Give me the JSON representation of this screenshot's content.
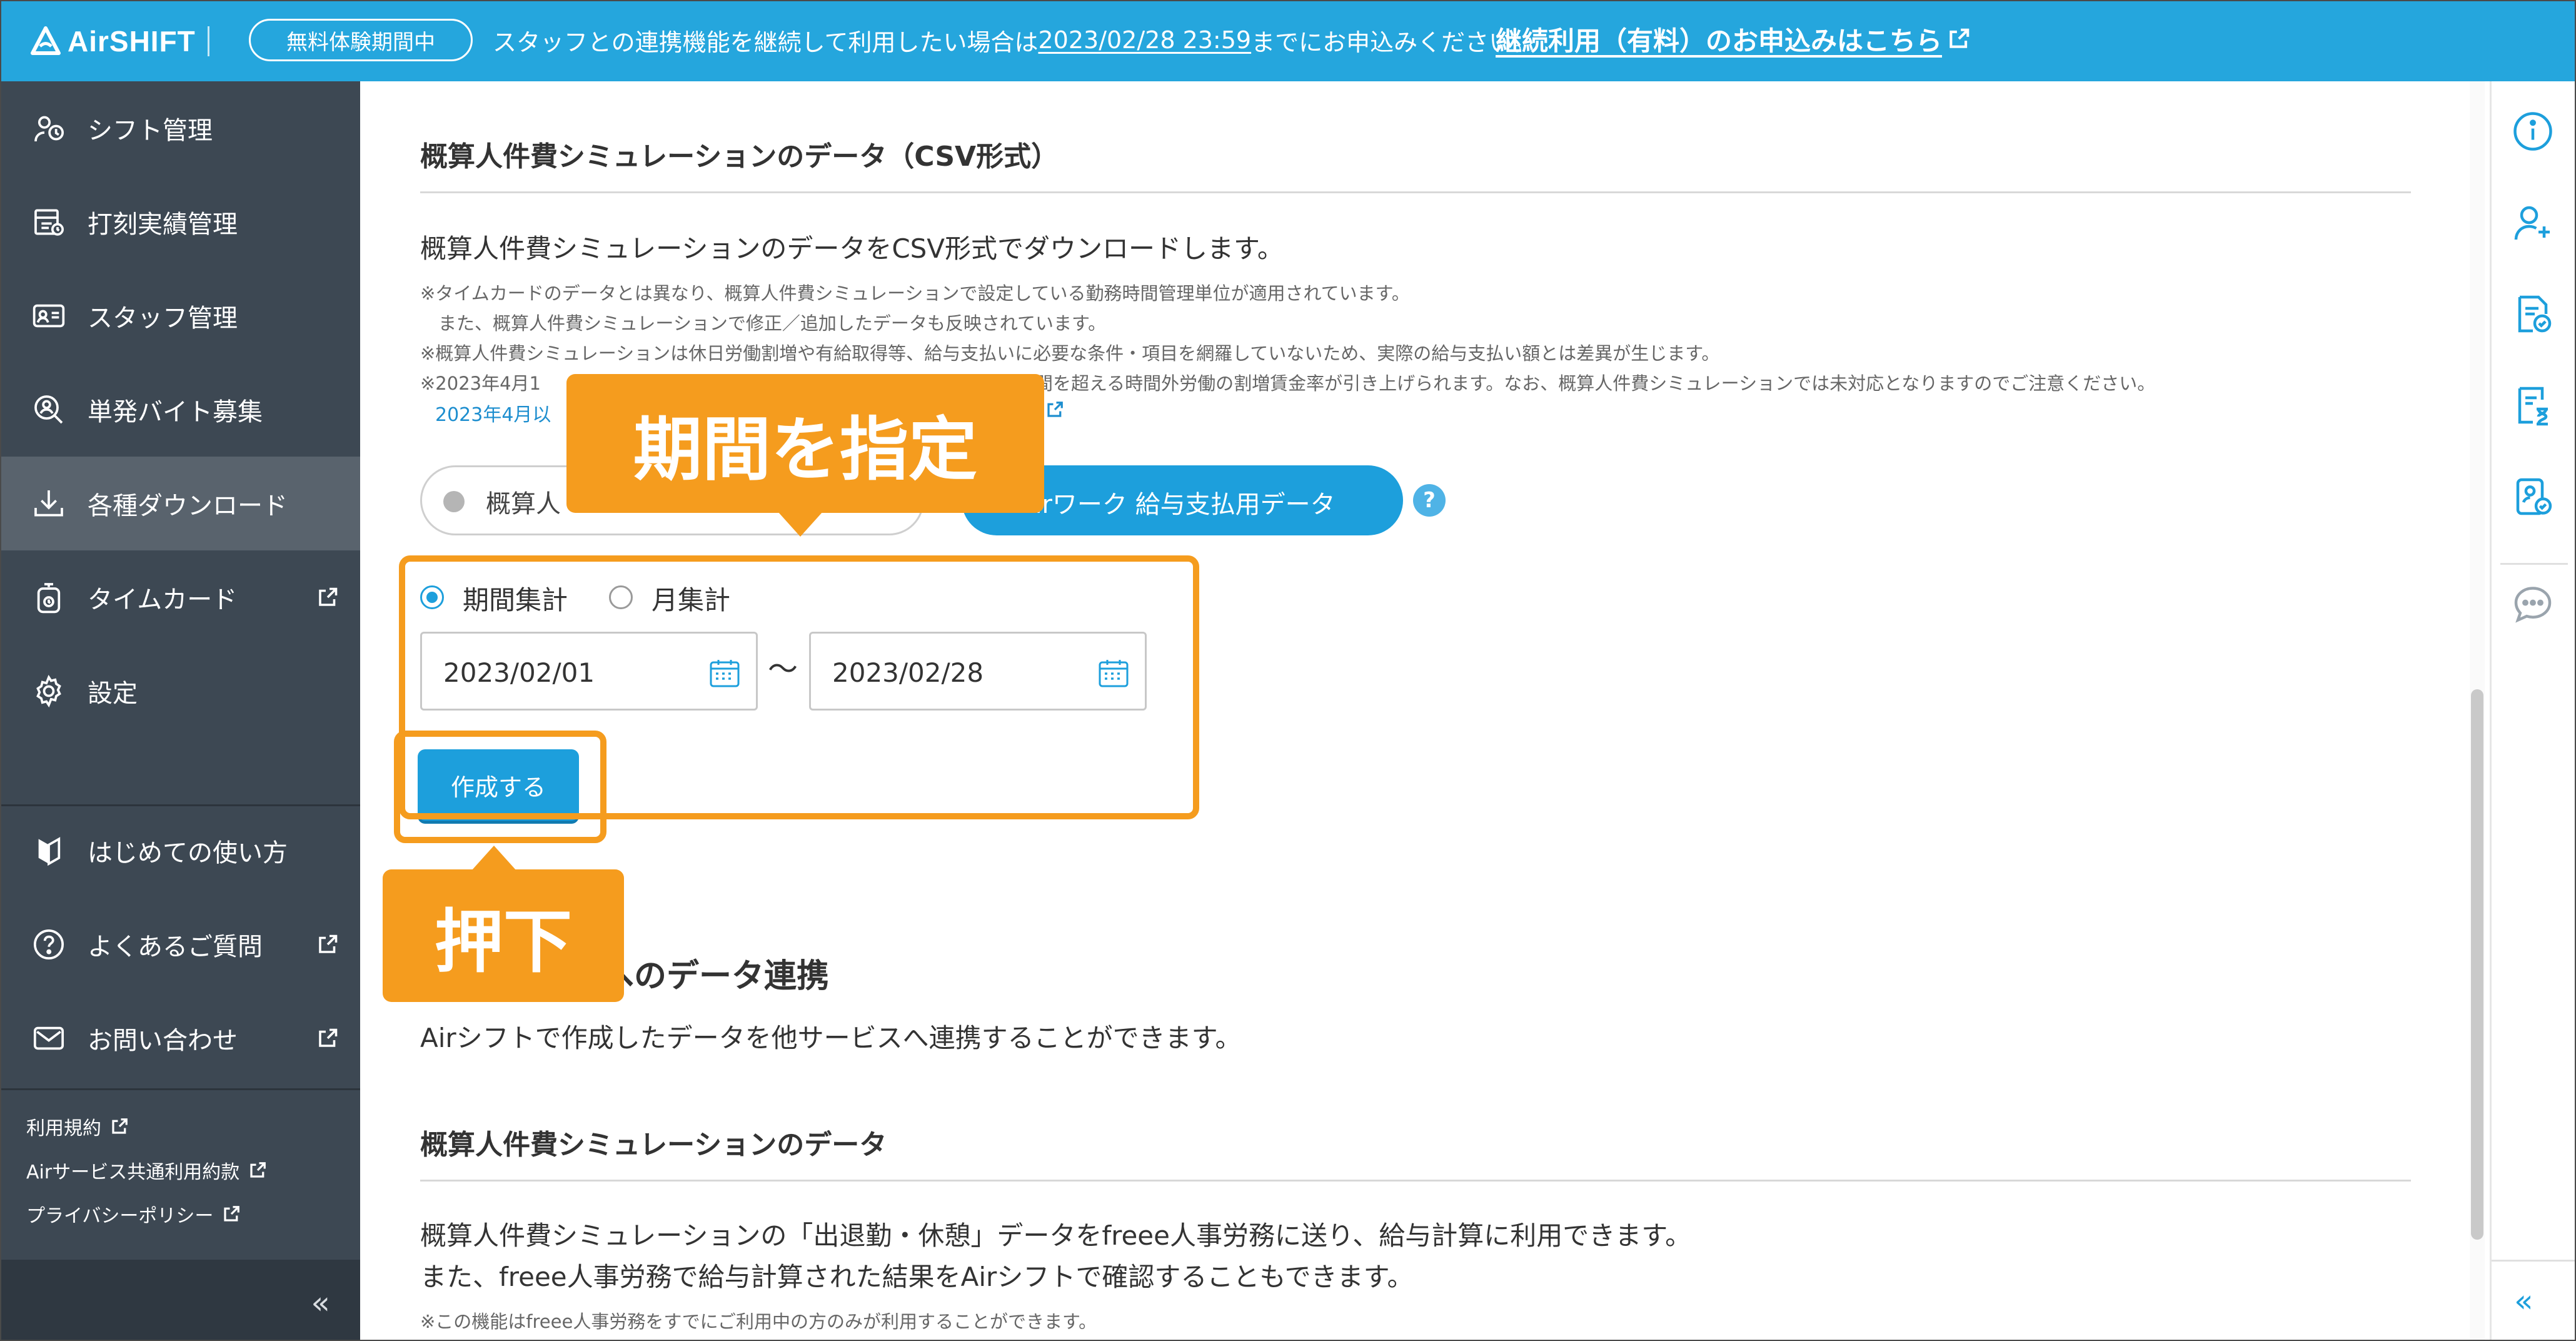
{
  "header": {
    "brand": "AirSHIFT",
    "trial_badge": "無料体験期間中",
    "message_prefix": "スタッフとの連携機能を継続して利用したい場合は",
    "message_date": "2023/02/28 23:59",
    "message_suffix": "までにお申込みください。",
    "cta_link": "継続利用（有料）のお申込みはこちら"
  },
  "sidebar": {
    "items": [
      {
        "label": "シフト管理",
        "icon": "shift-icon"
      },
      {
        "label": "打刻実績管理",
        "icon": "timesheet-icon"
      },
      {
        "label": "スタッフ管理",
        "icon": "staff-card-icon"
      },
      {
        "label": "単発バイト募集",
        "icon": "search-person-icon"
      },
      {
        "label": "各種ダウンロード",
        "icon": "download-icon"
      },
      {
        "label": "タイムカード",
        "icon": "time-card-icon"
      },
      {
        "label": "設定",
        "icon": "gear-icon"
      }
    ],
    "active_index": 4,
    "help_items": [
      {
        "label": "はじめての使い方",
        "icon": "beginner-icon"
      },
      {
        "label": "よくあるご質問",
        "icon": "question-icon"
      },
      {
        "label": "お問い合わせ",
        "icon": "mail-icon"
      }
    ],
    "footer_links": [
      "利用規約",
      "Airサービス共通利用約款",
      "プライバシーポリシー"
    ],
    "collapse": "«"
  },
  "main": {
    "csv_section": {
      "title": "概算人件費シミュレーションのデータ（CSV形式）",
      "description": "概算人件費シミュレーションのデータをCSV形式でダウンロードします。",
      "notes": [
        "※タイムカードのデータとは異なり、概算人件費シミュレーションで設定している勤務時間管理単位が適用されています。",
        "　また、概算人件費シミュレーションで修正／追加したデータも反映されています。",
        "※概算人件費シミュレーションは休日労働割増や有給取得等、給与支払いに必要な条件・項目を網羅していないため、実際の給与支払い額とは差異が生じます。",
        "※2023年4月1",
        "時間を超える時間外労働の割増賃金率が引き上げられます。なお、概算人件費シミュレーションでは未対応となりますのでご注意ください。"
      ],
      "note_link": "2023年4月以",
      "format_options": [
        "概算人",
        "Airワーク 給与支払用データ"
      ],
      "help": "?",
      "period_options": [
        "期間集計",
        "月集計"
      ],
      "date_from": "2023/02/01",
      "date_to": "2023/02/28",
      "tilde": "〜",
      "create_button": "作成する"
    },
    "link_section": {
      "title_partial": "へのデータ連携",
      "description": "Airシフトで作成したデータを他サービスへ連携することができます。"
    },
    "freee_section": {
      "title": "概算人件費シミュレーションのデータ",
      "line1": "概算人件費シミュレーションの「出退勤・休憩」データをfreee人事労務に送り、給与計算に利用できます。",
      "line2": "また、freee人事労務で給与計算された結果をAirシフトで確認することもできます。",
      "note": "※この機能はfreee人事労務をすでにご利用中の方のみが利用することができます。"
    }
  },
  "annotations": {
    "period_callout": "期間を指定",
    "press_callout": "押下",
    "color": "#f59c1e"
  },
  "right_rail": {
    "icons": [
      "info-icon",
      "add-user-icon",
      "document-check-icon",
      "hourglass-document-icon",
      "staff-check-icon",
      "chat-icon"
    ],
    "collapse": "«"
  },
  "colors": {
    "brand": "#25a6dd",
    "sidebar": "#3d4853",
    "primary_button": "#1d9fdc",
    "annotation": "#f59c1e"
  }
}
